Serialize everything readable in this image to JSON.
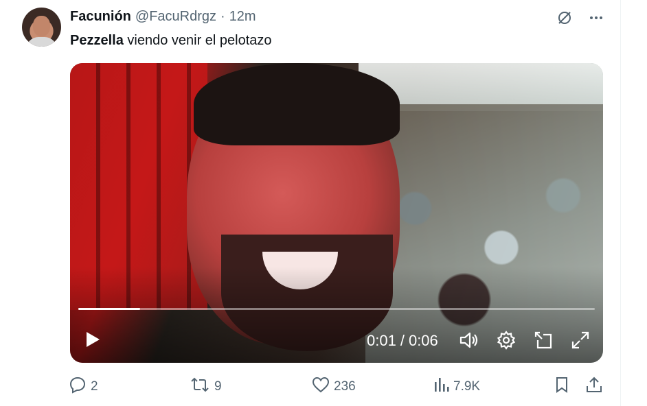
{
  "tweet": {
    "display_name": "Facunión",
    "handle": "@FacuRdrgz",
    "separator": "·",
    "time": "12m",
    "text_bold": "Pezzella",
    "text_rest": " viendo venir el pelotazo"
  },
  "video": {
    "current_time": "0:01",
    "time_separator": "/",
    "duration": "0:06",
    "progress_fraction": 0.12
  },
  "actions": {
    "replies": "2",
    "retweets": "9",
    "likes": "236",
    "views": "7.9K"
  },
  "icons": {
    "grok": "grok-icon",
    "more": "more-icon",
    "play": "play-icon",
    "volume": "volume-icon",
    "settings": "gear-icon",
    "pip": "pip-icon",
    "fullscreen": "fullscreen-icon",
    "reply": "reply-icon",
    "retweet": "retweet-icon",
    "like": "heart-icon",
    "views": "views-icon",
    "bookmark": "bookmark-icon",
    "share": "share-icon"
  },
  "colors": {
    "text_primary": "#0f1419",
    "text_secondary": "#536471",
    "border": "#eff3f4"
  }
}
